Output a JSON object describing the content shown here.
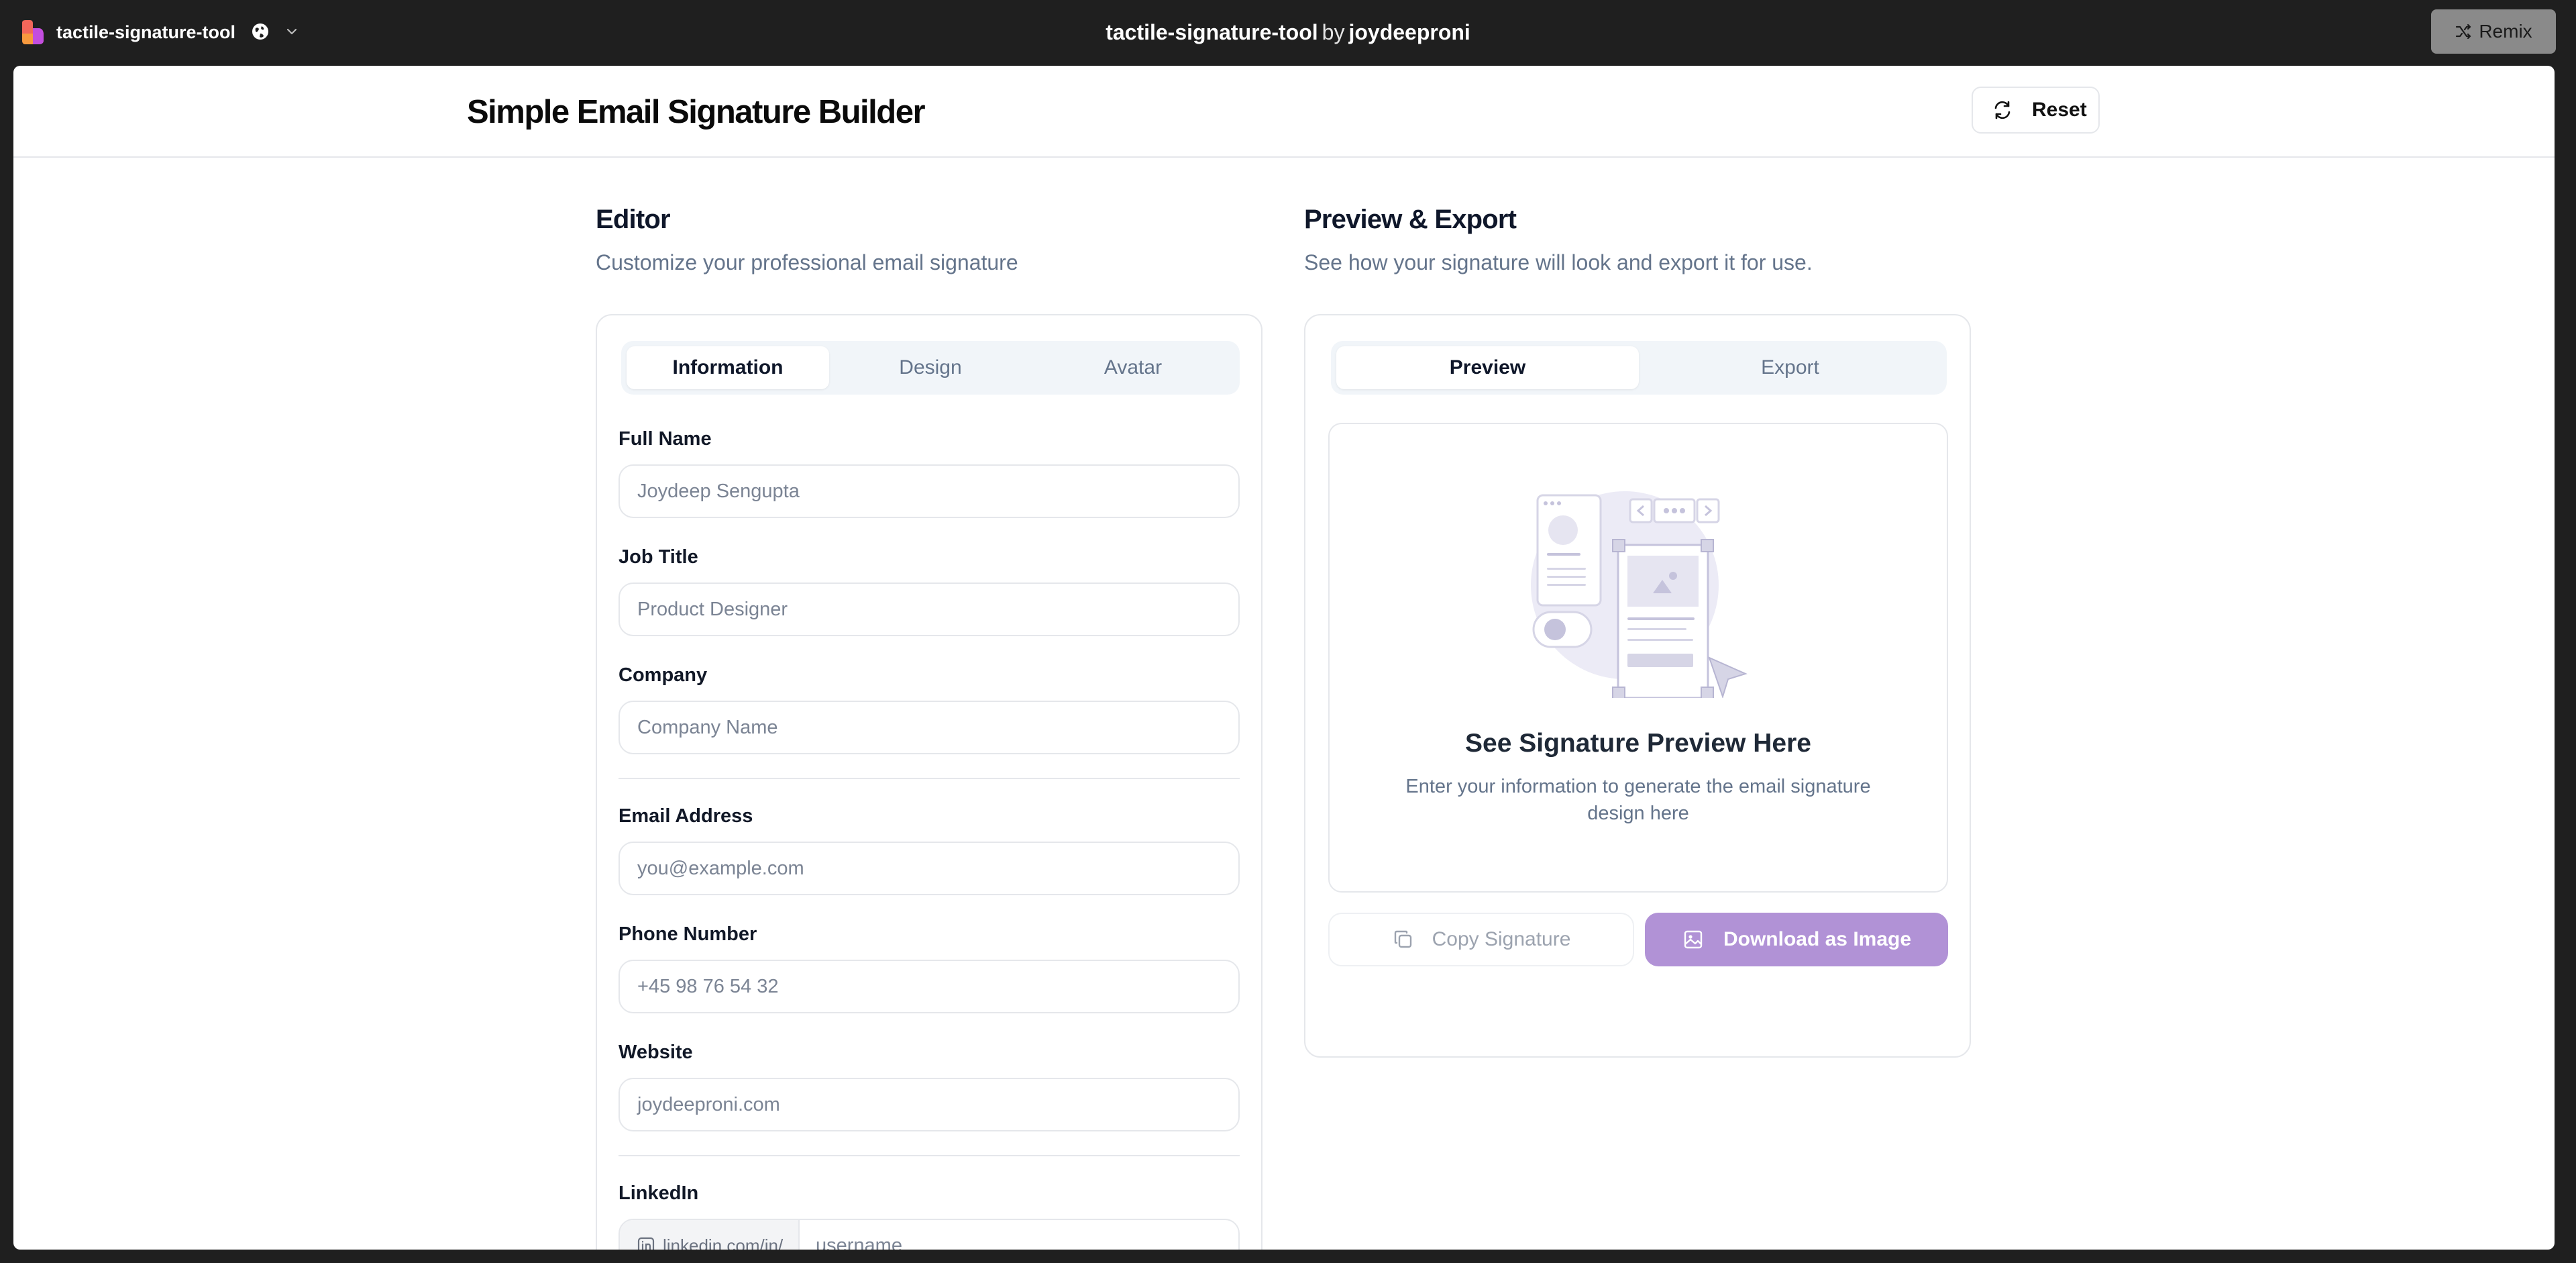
{
  "topbar": {
    "app_name": "tactile-signature-tool",
    "project": "tactile-signature-tool",
    "by": "by",
    "author": "joydeeproni",
    "remix_label": "Remix"
  },
  "header": {
    "title": "Simple Email Signature Builder",
    "reset_label": "Reset"
  },
  "editor": {
    "title": "Editor",
    "subtitle": "Customize your professional email signature",
    "tabs": [
      {
        "label": "Information",
        "active": true
      },
      {
        "label": "Design",
        "active": false
      },
      {
        "label": "Avatar",
        "active": false
      }
    ],
    "fields": {
      "full_name": {
        "label": "Full Name",
        "placeholder": "Joydeep Sengupta"
      },
      "job_title": {
        "label": "Job Title",
        "placeholder": "Product Designer"
      },
      "company": {
        "label": "Company",
        "placeholder": "Company Name"
      },
      "email": {
        "label": "Email Address",
        "placeholder": "you@example.com"
      },
      "phone": {
        "label": "Phone Number",
        "placeholder": "+45 98 76 54 32"
      },
      "website": {
        "label": "Website",
        "placeholder": "joydeeproni.com"
      },
      "linkedin": {
        "label": "LinkedIn",
        "prefix": "linkedin.com/in/",
        "placeholder": "username"
      }
    }
  },
  "preview": {
    "title": "Preview & Export",
    "subtitle": "See how your signature will look and export it for use.",
    "tabs": [
      {
        "label": "Preview",
        "active": true
      },
      {
        "label": "Export",
        "active": false
      }
    ],
    "empty_title": "See Signature Preview Here",
    "empty_text": "Enter your information to generate the email signature design here",
    "copy_label": "Copy Signature",
    "download_label": "Download as Image",
    "accent_color": "#b192d6"
  }
}
